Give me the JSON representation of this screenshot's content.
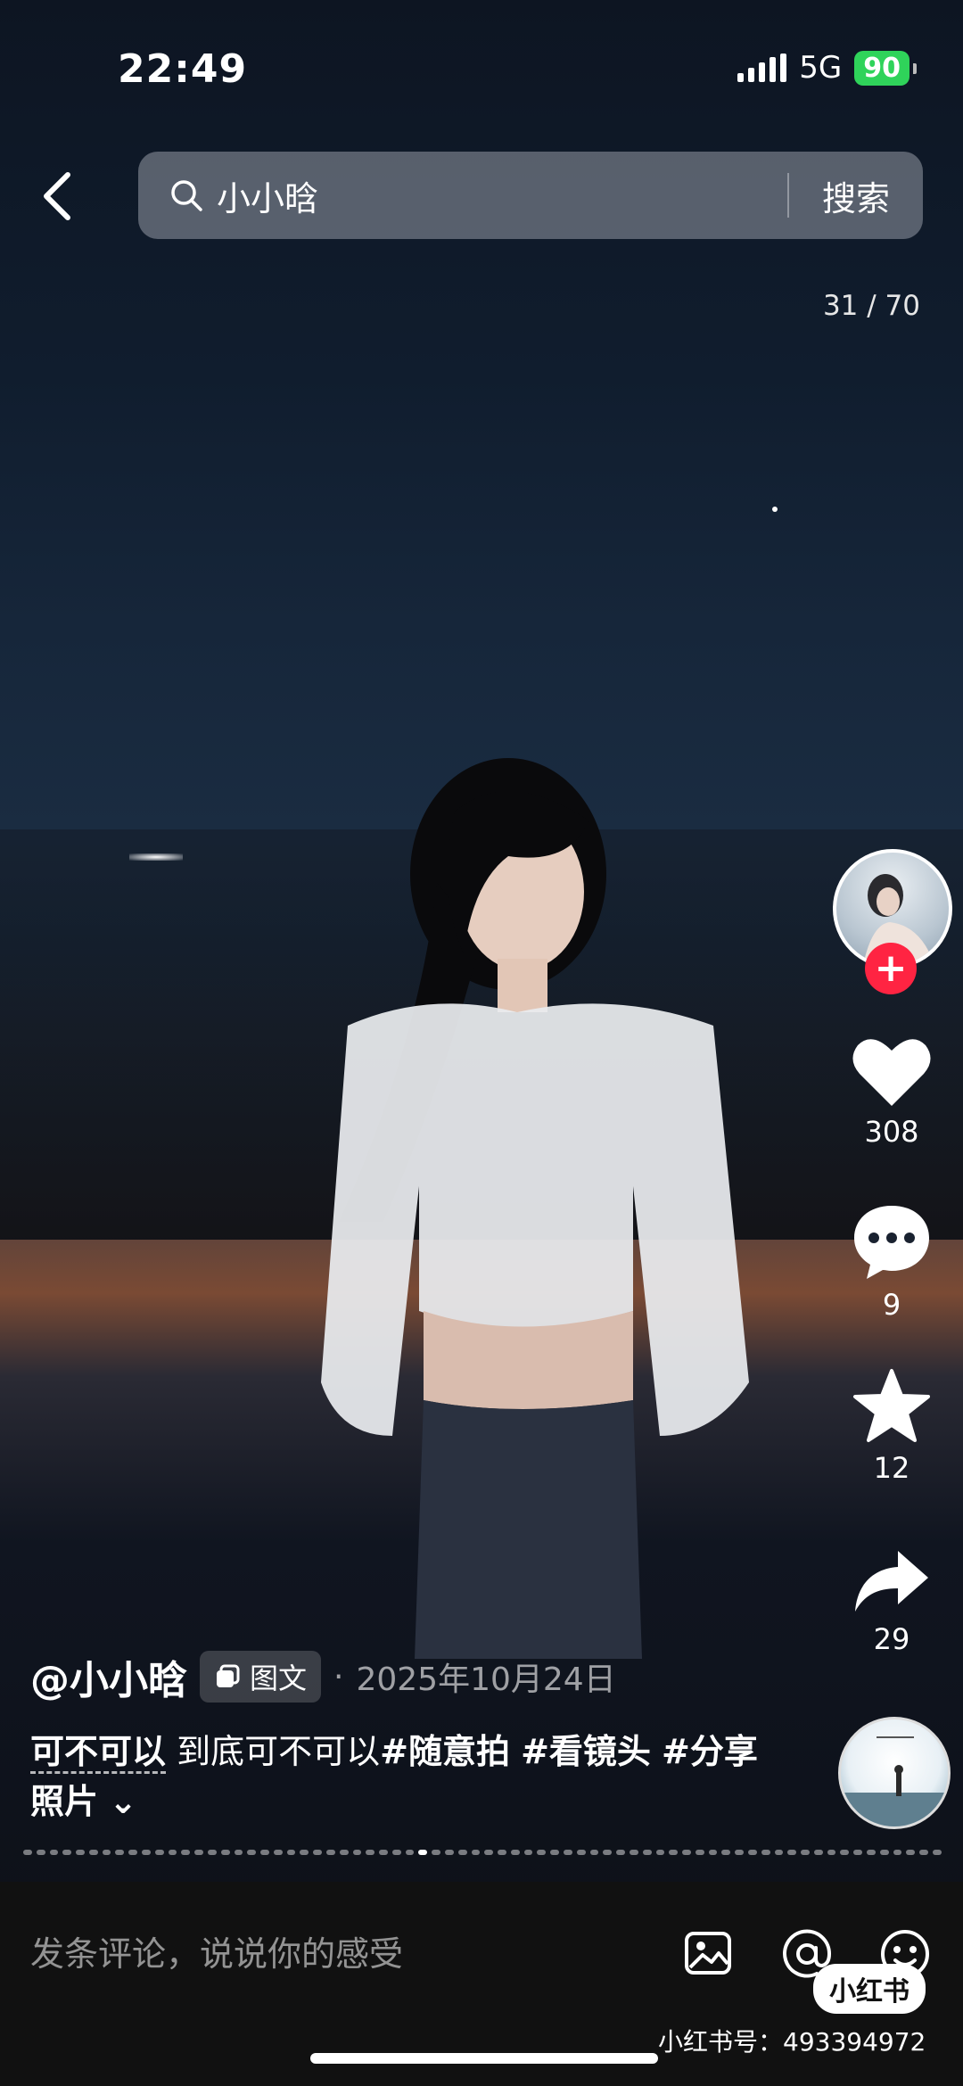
{
  "status_bar": {
    "time": "22:49",
    "network": "5G",
    "battery": "90"
  },
  "search": {
    "query": "小小晗",
    "button_label": "搜索"
  },
  "gallery": {
    "counter": "31 / 70",
    "total_images": 70,
    "current_index": 31
  },
  "author": {
    "handle": "@小小晗",
    "follow_symbol": "+"
  },
  "post": {
    "type_label": "图文",
    "separator": "·",
    "date": "2025年10月24日",
    "title": "可不可以",
    "text": "到底可不可以",
    "tags": [
      "#随意拍",
      "#看镜头",
      "#分享照片"
    ],
    "expand_symbol": "⌄"
  },
  "actions": {
    "likes": "308",
    "comments": "9",
    "favorites": "12",
    "shares": "29"
  },
  "comment_bar": {
    "placeholder": "发条评论，说说你的感受"
  },
  "watermark": {
    "brand": "小红书",
    "id_text": "小红书号：493394972"
  },
  "colors": {
    "accent": "#ff2442",
    "battery": "#2fd35a"
  }
}
